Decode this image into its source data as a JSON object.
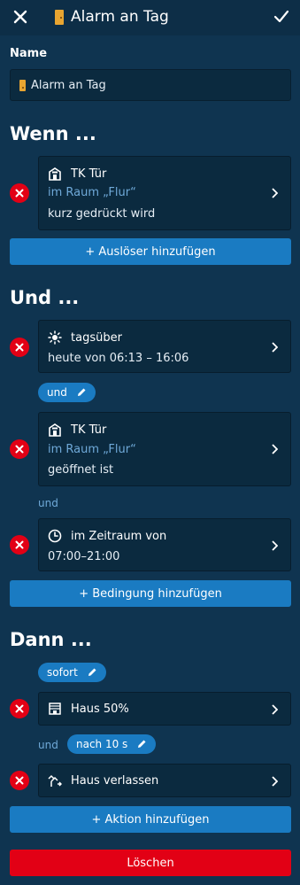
{
  "header": {
    "title": "Alarm an Tag"
  },
  "name_section": {
    "label": "Name",
    "value": "Alarm an Tag"
  },
  "wenn": {
    "title": "Wenn ...",
    "trigger": {
      "device": "TK Tür",
      "room": "im Raum „Flur“",
      "condition": "kurz gedrückt wird"
    },
    "add_label": "+ Auslöser hinzufügen"
  },
  "und": {
    "title": "Und ...",
    "cond1": {
      "title": "tagsüber",
      "detail": "heute von 06:13 – 16:06"
    },
    "operator_pill": "und",
    "cond2": {
      "device": "TK Tür",
      "room": "im Raum „Flur“",
      "state": "geöffnet ist"
    },
    "operator_text": "und",
    "cond3": {
      "title": "im Zeitraum von",
      "detail": "07:00–21:00"
    },
    "add_label": "+ Bedingung hinzufügen"
  },
  "dann": {
    "title": "Dann ...",
    "timing_pill": "sofort",
    "action1": {
      "label": "Haus 50%"
    },
    "operator_text": "und",
    "delay_pill": "nach 10 s",
    "action2": {
      "label": "Haus verlassen"
    },
    "add_label": "+ Aktion hinzufügen"
  },
  "delete_label": "Löschen",
  "colors": {
    "background": "#0f3450",
    "card": "#0b2a3f",
    "accent": "#1a7bc2",
    "danger": "#e20015",
    "muted": "#6fa9d8"
  }
}
